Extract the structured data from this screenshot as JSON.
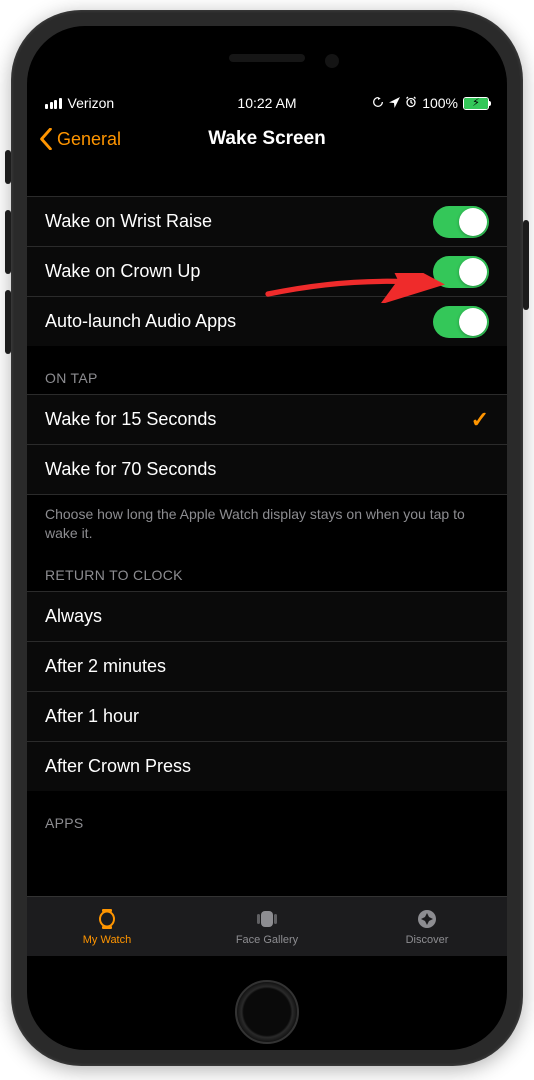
{
  "status_bar": {
    "carrier": "Verizon",
    "time": "10:22 AM",
    "battery_percent": "100%"
  },
  "nav": {
    "back_label": "General",
    "title": "Wake Screen"
  },
  "toggles": [
    {
      "label": "Wake on Wrist Raise",
      "on": true
    },
    {
      "label": "Wake on Crown Up",
      "on": true
    },
    {
      "label": "Auto-launch Audio Apps",
      "on": true
    }
  ],
  "on_tap": {
    "header": "ON TAP",
    "options": [
      {
        "label": "Wake for 15 Seconds",
        "selected": true
      },
      {
        "label": "Wake for 70 Seconds",
        "selected": false
      }
    ],
    "footer": "Choose how long the Apple Watch display stays on when you tap to wake it."
  },
  "return_to_clock": {
    "header": "RETURN TO CLOCK",
    "options": [
      {
        "label": "Always"
      },
      {
        "label": "After 2 minutes"
      },
      {
        "label": "After 1 hour"
      },
      {
        "label": "After Crown Press"
      }
    ]
  },
  "apps": {
    "header": "APPS"
  },
  "tabs": {
    "my_watch": "My Watch",
    "face_gallery": "Face Gallery",
    "discover": "Discover"
  }
}
